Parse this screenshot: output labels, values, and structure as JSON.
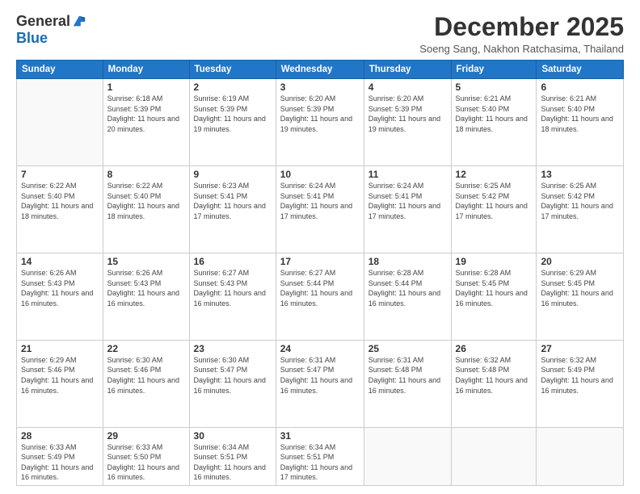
{
  "logo": {
    "general": "General",
    "blue": "Blue"
  },
  "title": "December 2025",
  "subtitle": "Soeng Sang, Nakhon Ratchasima, Thailand",
  "days_of_week": [
    "Sunday",
    "Monday",
    "Tuesday",
    "Wednesday",
    "Thursday",
    "Friday",
    "Saturday"
  ],
  "weeks": [
    [
      {
        "day": "",
        "sunrise": "",
        "sunset": "",
        "daylight": ""
      },
      {
        "day": "1",
        "sunrise": "Sunrise: 6:18 AM",
        "sunset": "Sunset: 5:39 PM",
        "daylight": "Daylight: 11 hours and 20 minutes."
      },
      {
        "day": "2",
        "sunrise": "Sunrise: 6:19 AM",
        "sunset": "Sunset: 5:39 PM",
        "daylight": "Daylight: 11 hours and 19 minutes."
      },
      {
        "day": "3",
        "sunrise": "Sunrise: 6:20 AM",
        "sunset": "Sunset: 5:39 PM",
        "daylight": "Daylight: 11 hours and 19 minutes."
      },
      {
        "day": "4",
        "sunrise": "Sunrise: 6:20 AM",
        "sunset": "Sunset: 5:39 PM",
        "daylight": "Daylight: 11 hours and 19 minutes."
      },
      {
        "day": "5",
        "sunrise": "Sunrise: 6:21 AM",
        "sunset": "Sunset: 5:40 PM",
        "daylight": "Daylight: 11 hours and 18 minutes."
      },
      {
        "day": "6",
        "sunrise": "Sunrise: 6:21 AM",
        "sunset": "Sunset: 5:40 PM",
        "daylight": "Daylight: 11 hours and 18 minutes."
      }
    ],
    [
      {
        "day": "7",
        "sunrise": "Sunrise: 6:22 AM",
        "sunset": "Sunset: 5:40 PM",
        "daylight": "Daylight: 11 hours and 18 minutes."
      },
      {
        "day": "8",
        "sunrise": "Sunrise: 6:22 AM",
        "sunset": "Sunset: 5:40 PM",
        "daylight": "Daylight: 11 hours and 18 minutes."
      },
      {
        "day": "9",
        "sunrise": "Sunrise: 6:23 AM",
        "sunset": "Sunset: 5:41 PM",
        "daylight": "Daylight: 11 hours and 17 minutes."
      },
      {
        "day": "10",
        "sunrise": "Sunrise: 6:24 AM",
        "sunset": "Sunset: 5:41 PM",
        "daylight": "Daylight: 11 hours and 17 minutes."
      },
      {
        "day": "11",
        "sunrise": "Sunrise: 6:24 AM",
        "sunset": "Sunset: 5:41 PM",
        "daylight": "Daylight: 11 hours and 17 minutes."
      },
      {
        "day": "12",
        "sunrise": "Sunrise: 6:25 AM",
        "sunset": "Sunset: 5:42 PM",
        "daylight": "Daylight: 11 hours and 17 minutes."
      },
      {
        "day": "13",
        "sunrise": "Sunrise: 6:25 AM",
        "sunset": "Sunset: 5:42 PM",
        "daylight": "Daylight: 11 hours and 17 minutes."
      }
    ],
    [
      {
        "day": "14",
        "sunrise": "Sunrise: 6:26 AM",
        "sunset": "Sunset: 5:43 PM",
        "daylight": "Daylight: 11 hours and 16 minutes."
      },
      {
        "day": "15",
        "sunrise": "Sunrise: 6:26 AM",
        "sunset": "Sunset: 5:43 PM",
        "daylight": "Daylight: 11 hours and 16 minutes."
      },
      {
        "day": "16",
        "sunrise": "Sunrise: 6:27 AM",
        "sunset": "Sunset: 5:43 PM",
        "daylight": "Daylight: 11 hours and 16 minutes."
      },
      {
        "day": "17",
        "sunrise": "Sunrise: 6:27 AM",
        "sunset": "Sunset: 5:44 PM",
        "daylight": "Daylight: 11 hours and 16 minutes."
      },
      {
        "day": "18",
        "sunrise": "Sunrise: 6:28 AM",
        "sunset": "Sunset: 5:44 PM",
        "daylight": "Daylight: 11 hours and 16 minutes."
      },
      {
        "day": "19",
        "sunrise": "Sunrise: 6:28 AM",
        "sunset": "Sunset: 5:45 PM",
        "daylight": "Daylight: 11 hours and 16 minutes."
      },
      {
        "day": "20",
        "sunrise": "Sunrise: 6:29 AM",
        "sunset": "Sunset: 5:45 PM",
        "daylight": "Daylight: 11 hours and 16 minutes."
      }
    ],
    [
      {
        "day": "21",
        "sunrise": "Sunrise: 6:29 AM",
        "sunset": "Sunset: 5:46 PM",
        "daylight": "Daylight: 11 hours and 16 minutes."
      },
      {
        "day": "22",
        "sunrise": "Sunrise: 6:30 AM",
        "sunset": "Sunset: 5:46 PM",
        "daylight": "Daylight: 11 hours and 16 minutes."
      },
      {
        "day": "23",
        "sunrise": "Sunrise: 6:30 AM",
        "sunset": "Sunset: 5:47 PM",
        "daylight": "Daylight: 11 hours and 16 minutes."
      },
      {
        "day": "24",
        "sunrise": "Sunrise: 6:31 AM",
        "sunset": "Sunset: 5:47 PM",
        "daylight": "Daylight: 11 hours and 16 minutes."
      },
      {
        "day": "25",
        "sunrise": "Sunrise: 6:31 AM",
        "sunset": "Sunset: 5:48 PM",
        "daylight": "Daylight: 11 hours and 16 minutes."
      },
      {
        "day": "26",
        "sunrise": "Sunrise: 6:32 AM",
        "sunset": "Sunset: 5:48 PM",
        "daylight": "Daylight: 11 hours and 16 minutes."
      },
      {
        "day": "27",
        "sunrise": "Sunrise: 6:32 AM",
        "sunset": "Sunset: 5:49 PM",
        "daylight": "Daylight: 11 hours and 16 minutes."
      }
    ],
    [
      {
        "day": "28",
        "sunrise": "Sunrise: 6:33 AM",
        "sunset": "Sunset: 5:49 PM",
        "daylight": "Daylight: 11 hours and 16 minutes."
      },
      {
        "day": "29",
        "sunrise": "Sunrise: 6:33 AM",
        "sunset": "Sunset: 5:50 PM",
        "daylight": "Daylight: 11 hours and 16 minutes."
      },
      {
        "day": "30",
        "sunrise": "Sunrise: 6:34 AM",
        "sunset": "Sunset: 5:51 PM",
        "daylight": "Daylight: 11 hours and 16 minutes."
      },
      {
        "day": "31",
        "sunrise": "Sunrise: 6:34 AM",
        "sunset": "Sunset: 5:51 PM",
        "daylight": "Daylight: 11 hours and 17 minutes."
      },
      {
        "day": "",
        "sunrise": "",
        "sunset": "",
        "daylight": ""
      },
      {
        "day": "",
        "sunrise": "",
        "sunset": "",
        "daylight": ""
      },
      {
        "day": "",
        "sunrise": "",
        "sunset": "",
        "daylight": ""
      }
    ]
  ]
}
